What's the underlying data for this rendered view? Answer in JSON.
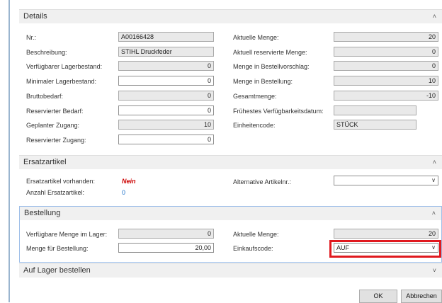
{
  "details": {
    "header": "Details",
    "left": [
      {
        "label": "Nr.:",
        "value": "A00166428",
        "type": "ro",
        "align": "left"
      },
      {
        "label": "Beschreibung:",
        "value": "STIHL Druckfeder",
        "type": "ro",
        "align": "left"
      },
      {
        "label": "Verfügbarer Lagerbestand:",
        "value": "0",
        "type": "ro",
        "align": "right"
      },
      {
        "label": "Minimaler Lagerbestand:",
        "value": "0",
        "type": "ed",
        "align": "right"
      },
      {
        "label": "Bruttobedarf:",
        "value": "0",
        "type": "ro",
        "align": "right"
      },
      {
        "label": "Reservierter Bedarf:",
        "value": "0",
        "type": "ed",
        "align": "right"
      },
      {
        "label": "Geplanter Zugang:",
        "value": "10",
        "type": "ro",
        "align": "right"
      },
      {
        "label": "Reservierter Zugang:",
        "value": "0",
        "type": "ed",
        "align": "right"
      }
    ],
    "right": [
      {
        "label": "Aktuelle Menge:",
        "value": "20",
        "type": "ro",
        "align": "right"
      },
      {
        "label": "Aktuell reservierte Menge:",
        "value": "0",
        "type": "ro",
        "align": "right"
      },
      {
        "label": "Menge in Bestellvorschlag:",
        "value": "0",
        "type": "ro",
        "align": "right"
      },
      {
        "label": "Menge in Bestellung:",
        "value": "10",
        "type": "ro",
        "align": "right"
      },
      {
        "label": "Gesamtmenge:",
        "value": "-10",
        "type": "ro",
        "align": "right"
      },
      {
        "label": "Frühestes Verfügbarkeitsdatum:",
        "value": "",
        "type": "ro",
        "align": "left"
      },
      {
        "label": "Einheitencode:",
        "value": "STÜCK",
        "type": "ro",
        "align": "left"
      }
    ]
  },
  "ersatz": {
    "header": "Ersatzartikel",
    "vorhanden_label": "Ersatzartikel vorhanden:",
    "vorhanden_value": "Nein",
    "anzahl_label": "Anzahl Ersatzartikel:",
    "anzahl_value": "0",
    "alt_label": "Alternative Artikelnr.:",
    "alt_value": ""
  },
  "bestellung": {
    "header": "Bestellung",
    "verf_label": "Verfügbare Menge im Lager:",
    "verf_value": "0",
    "menge_label": "Menge für Bestellung:",
    "menge_value": "20,00",
    "akt_label": "Aktuelle Menge:",
    "akt_value": "20",
    "einkauf_label": "Einkaufscode:",
    "einkauf_value": "AUF"
  },
  "lager": {
    "header": "Auf Lager bestellen"
  },
  "buttons": {
    "ok": "OK",
    "cancel": "Abbrechen"
  },
  "colors": {
    "highlight": "#e0191f",
    "nein": "#cc0000",
    "link": "#1a6fc9"
  }
}
